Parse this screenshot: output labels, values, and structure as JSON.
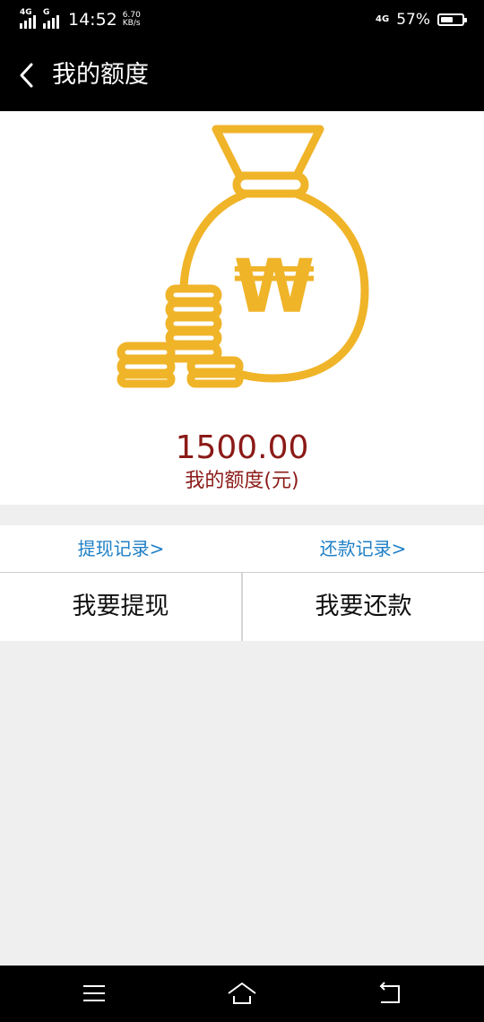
{
  "status_bar": {
    "network_1": "4G",
    "network_2": "G",
    "time": "14:52",
    "speed_value": "6.70",
    "speed_unit": "KB/s",
    "network_right": "4G",
    "battery_percent": "57%",
    "battery_level": 0.57
  },
  "header": {
    "title": "我的额度",
    "back_icon": "chevron-left-icon"
  },
  "hero": {
    "illustration": "money-bag-icon",
    "currency_symbol": "₩",
    "amount": "1500.00",
    "amount_label": "我的额度(元)",
    "accent_color": "#f0b429"
  },
  "links": {
    "withdraw_records": "提现记录>",
    "repay_records": "还款记录>"
  },
  "actions": {
    "withdraw": "我要提现",
    "repay": "我要还款"
  },
  "nav_bar": {
    "menu_icon": "menu-icon",
    "home_icon": "home-icon",
    "back_icon": "back-icon"
  }
}
